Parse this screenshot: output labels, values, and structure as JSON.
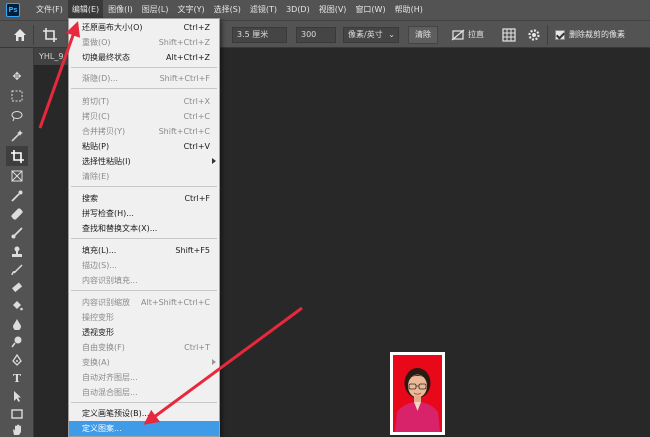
{
  "menubar": {
    "logo": "Ps",
    "items": [
      "文件(F)",
      "编辑(E)",
      "图像(I)",
      "图层(L)",
      "文字(Y)",
      "选择(S)",
      "滤镜(T)",
      "3D(D)",
      "视图(V)",
      "窗口(W)",
      "帮助(H)"
    ],
    "active_index": 1
  },
  "options": {
    "width_value": "3.5 厘米",
    "resolution_value": "300",
    "unit_select": "像素/英寸",
    "clear_button": "清除",
    "straighten_label": "拉直",
    "delete_cropped_label": "删除裁剪的像素",
    "delete_cropped_checked": true
  },
  "document": {
    "tab_label": "YHL_9"
  },
  "edit_menu": {
    "items": [
      {
        "label": "还原画布大小(O)",
        "shortcut": "Ctrl+Z",
        "disabled": false,
        "submenu": false
      },
      {
        "label": "重做(O)",
        "shortcut": "Shift+Ctrl+Z",
        "disabled": true,
        "submenu": false
      },
      {
        "label": "切换最终状态",
        "shortcut": "Alt+Ctrl+Z",
        "disabled": false,
        "submenu": false
      },
      {
        "label": "渐隐(D)...",
        "shortcut": "Shift+Ctrl+F",
        "disabled": true,
        "submenu": false
      },
      {
        "label": "剪切(T)",
        "shortcut": "Ctrl+X",
        "disabled": true,
        "submenu": false
      },
      {
        "label": "拷贝(C)",
        "shortcut": "Ctrl+C",
        "disabled": true,
        "submenu": false
      },
      {
        "label": "合并拷贝(Y)",
        "shortcut": "Shift+Ctrl+C",
        "disabled": true,
        "submenu": false
      },
      {
        "label": "粘贴(P)",
        "shortcut": "Ctrl+V",
        "disabled": false,
        "submenu": false
      },
      {
        "label": "选择性粘贴(I)",
        "shortcut": "",
        "disabled": false,
        "submenu": true
      },
      {
        "label": "清除(E)",
        "shortcut": "",
        "disabled": true,
        "submenu": false
      },
      {
        "label": "搜索",
        "shortcut": "Ctrl+F",
        "disabled": false,
        "submenu": false
      },
      {
        "label": "拼写检查(H)...",
        "shortcut": "",
        "disabled": false,
        "submenu": false
      },
      {
        "label": "查找和替换文本(X)...",
        "shortcut": "",
        "disabled": false,
        "submenu": false
      },
      {
        "label": "填充(L)...",
        "shortcut": "Shift+F5",
        "disabled": false,
        "submenu": false
      },
      {
        "label": "描边(S)...",
        "shortcut": "",
        "disabled": true,
        "submenu": false
      },
      {
        "label": "内容识别填充...",
        "shortcut": "",
        "disabled": true,
        "submenu": false
      },
      {
        "label": "内容识别缩放",
        "shortcut": "Alt+Shift+Ctrl+C",
        "disabled": true,
        "submenu": false
      },
      {
        "label": "操控变形",
        "shortcut": "",
        "disabled": true,
        "submenu": false
      },
      {
        "label": "透视变形",
        "shortcut": "",
        "disabled": false,
        "submenu": false
      },
      {
        "label": "自由变换(F)",
        "shortcut": "Ctrl+T",
        "disabled": true,
        "submenu": false
      },
      {
        "label": "变换(A)",
        "shortcut": "",
        "disabled": true,
        "submenu": true
      },
      {
        "label": "自动对齐图层...",
        "shortcut": "",
        "disabled": true,
        "submenu": false
      },
      {
        "label": "自动混合图层...",
        "shortcut": "",
        "disabled": true,
        "submenu": false
      },
      {
        "label": "定义画笔预设(B)...",
        "shortcut": "",
        "disabled": false,
        "submenu": false
      },
      {
        "label": "定义图案...",
        "shortcut": "",
        "disabled": false,
        "submenu": false,
        "highlighted": true
      }
    ]
  },
  "colors": {
    "highlight": "#3f9ae8",
    "annotation_arrow": "#e8283c",
    "photo_background": "#e8081a"
  }
}
